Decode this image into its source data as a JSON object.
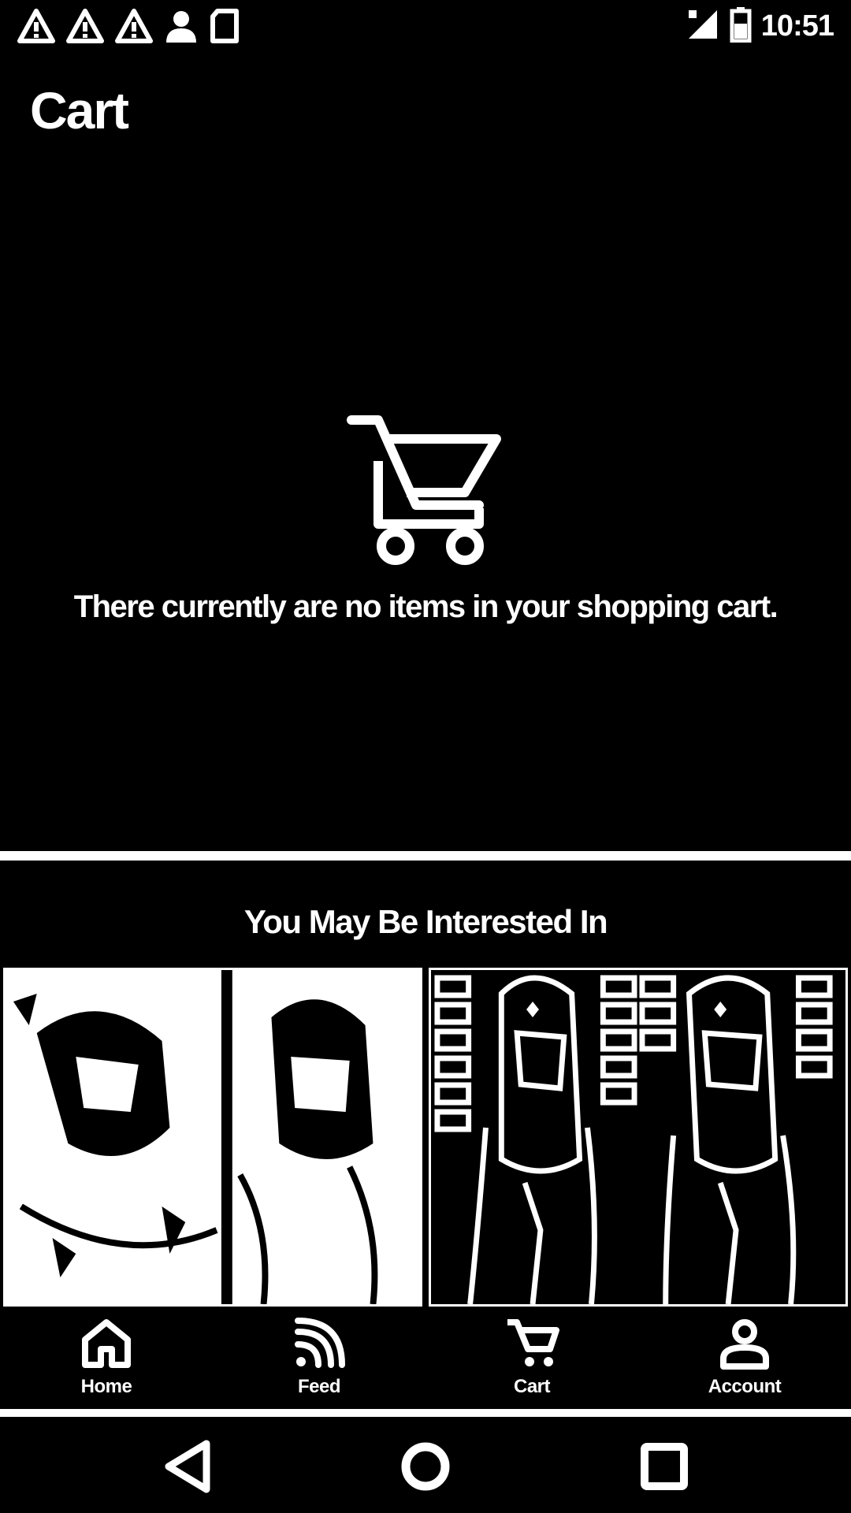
{
  "status_bar": {
    "time": "10:51",
    "icons": [
      "warning-icon",
      "warning-icon",
      "warning-icon",
      "account-icon",
      "sd-card-icon",
      "signal-icon",
      "battery-icon"
    ]
  },
  "page": {
    "title": "Cart"
  },
  "empty_state": {
    "icon": "cart-icon",
    "message": "There currently are no items in your shopping cart."
  },
  "recommendations": {
    "title": "You May Be Interested In",
    "items": [
      {
        "image": "product-photo-two-women"
      },
      {
        "image": "product-photo-two-women-brick-wall"
      }
    ]
  },
  "bottom_nav": {
    "items": [
      {
        "label": "Home",
        "icon": "home-icon"
      },
      {
        "label": "Feed",
        "icon": "feed-icon"
      },
      {
        "label": "Cart",
        "icon": "cart-icon"
      },
      {
        "label": "Account",
        "icon": "account-icon"
      }
    ]
  },
  "system_nav": {
    "buttons": [
      "back",
      "home",
      "recents"
    ]
  },
  "colors": {
    "background": "#000000",
    "foreground": "#ffffff"
  }
}
